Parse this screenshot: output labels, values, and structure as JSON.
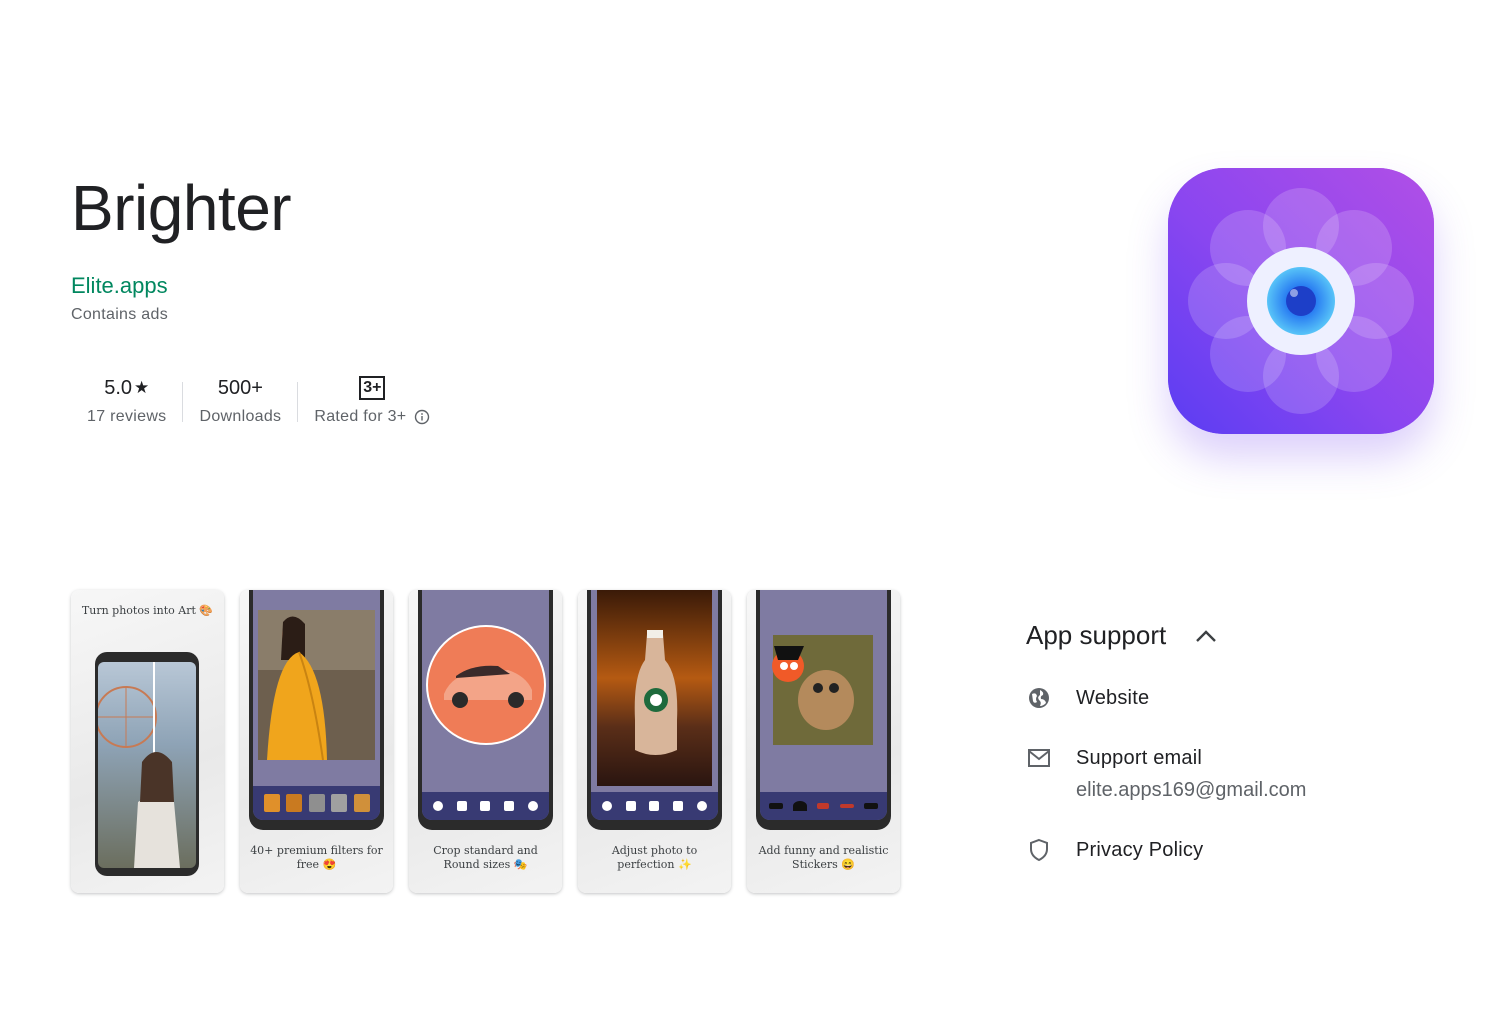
{
  "app": {
    "title": "Brighter",
    "developer": "Elite.apps",
    "ads_note": "Contains ads"
  },
  "stats": [
    {
      "value": "5.0",
      "label": "17 reviews",
      "icon": "star-icon"
    },
    {
      "value": "500+",
      "label": "Downloads"
    },
    {
      "value": "3+",
      "label": "Rated for 3+",
      "icon": "info-icon"
    }
  ],
  "screenshots": [
    {
      "caption": "Turn photos into Art 🎨"
    },
    {
      "caption": "40+ premium filters for free 😍"
    },
    {
      "caption": "Crop standard and Round sizes 🎭"
    },
    {
      "caption": "Adjust photo to perfection ✨"
    },
    {
      "caption": "Add funny and realistic Stickers 😄"
    }
  ],
  "support": {
    "title": "App support",
    "items": [
      {
        "label": "Website",
        "icon": "globe-icon"
      },
      {
        "label": "Support email",
        "sub": "elite.apps169@gmail.com",
        "icon": "mail-icon"
      },
      {
        "label": "Privacy Policy",
        "icon": "shield-icon"
      }
    ]
  },
  "colors": {
    "developer": "#01875f",
    "icon_gradient_start": "#b14fe6",
    "icon_gradient_end": "#5a3df3"
  }
}
